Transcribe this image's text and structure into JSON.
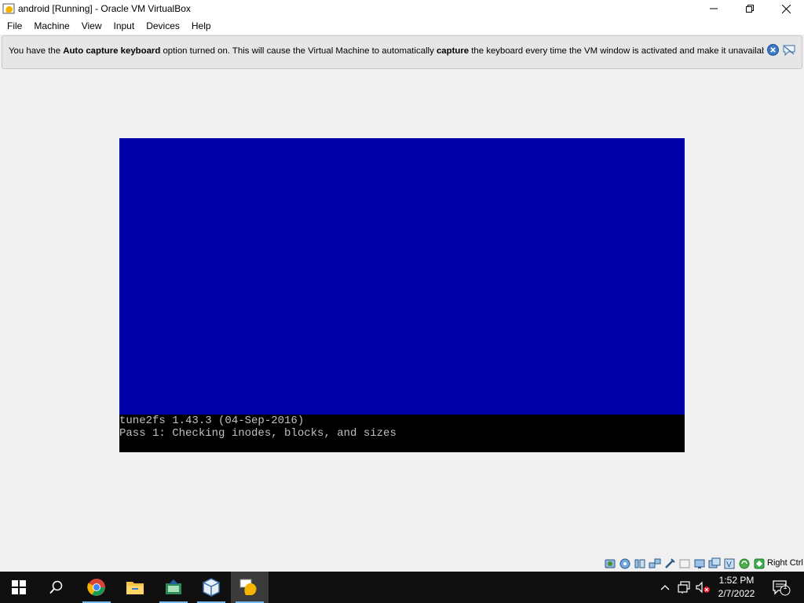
{
  "window": {
    "title": "android [Running] - Oracle VM VirtualBox"
  },
  "menu": [
    "File",
    "Machine",
    "View",
    "Input",
    "Devices",
    "Help"
  ],
  "banner": {
    "t1": "You have the ",
    "b1": "Auto capture keyboard",
    "t2": " option turned on. This will cause the Virtual Machine to automatically ",
    "b2": "capture",
    "t3": " the keyboard every time the VM window is activated and make it unavailable to"
  },
  "console": {
    "line1": "tune2fs 1.43.3 (04-Sep-2016)",
    "line2": "Pass 1: Checking inodes, blocks, and sizes"
  },
  "statusbar": {
    "host_key": "Right Ctrl",
    "icons": [
      "hard-disk-icon",
      "optical-drive-icon",
      "audio-icon",
      "network-icon",
      "usb-icon",
      "shared-folders-icon",
      "display-icon",
      "video-capture-icon",
      "mouse-integration-icon",
      "cpu-icon",
      "keyboard-capture-icon"
    ]
  },
  "taskbar": {
    "apps": [
      "start-button",
      "search-button",
      "chrome-app",
      "file-explorer-app",
      "app-editor",
      "virtualbox-app",
      "virtualbox-vm-app"
    ],
    "time": "1:52 PM",
    "date": "2/7/2022",
    "notification_count": "1"
  },
  "colors": {
    "vm_blue": "#0000a8",
    "taskbar": "#101010",
    "accent": "#76b9ed"
  }
}
